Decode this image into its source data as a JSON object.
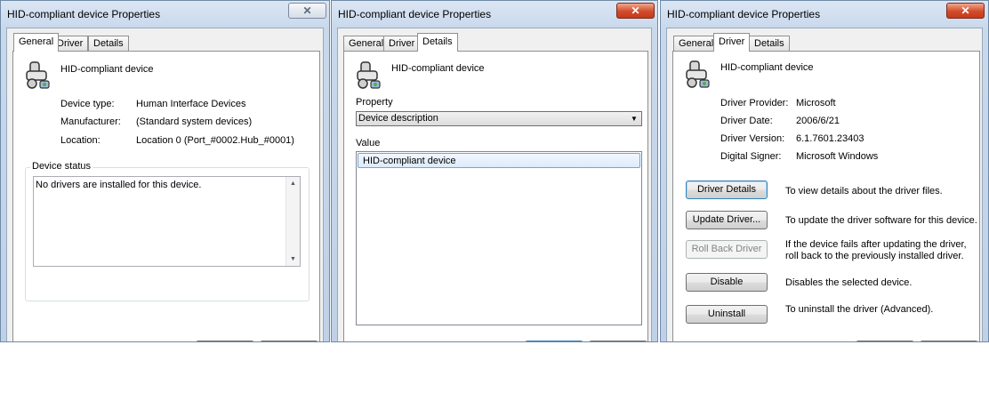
{
  "windows": [
    {
      "title": "HID-compliant device Properties",
      "close": "✕",
      "tabs": [
        "General",
        "Driver",
        "Details"
      ],
      "device_name": "HID-compliant device",
      "fields": [
        {
          "label": "Device type:",
          "value": "Human Interface Devices"
        },
        {
          "label": "Manufacturer:",
          "value": "(Standard system devices)"
        },
        {
          "label": "Location:",
          "value": "Location 0 (Port_#0002.Hub_#0001)"
        }
      ],
      "status_group_label": "Device status",
      "status_text": "No drivers are installed for this device."
    },
    {
      "title": "HID-compliant device Properties",
      "close": "✕",
      "tabs": [
        "General",
        "Driver",
        "Details"
      ],
      "device_name": "HID-compliant device",
      "property_label": "Property",
      "property_selected": "Device description",
      "value_label": "Value",
      "value_items": [
        "HID-compliant device"
      ]
    },
    {
      "title": "HID-compliant device Properties",
      "close": "✕",
      "tabs": [
        "General",
        "Driver",
        "Details"
      ],
      "device_name": "HID-compliant device",
      "fields": [
        {
          "label": "Driver Provider:",
          "value": "Microsoft"
        },
        {
          "label": "Driver Date:",
          "value": "2006/6/21"
        },
        {
          "label": "Driver Version:",
          "value": "6.1.7601.23403"
        },
        {
          "label": "Digital Signer:",
          "value": "Microsoft Windows"
        }
      ],
      "actions": [
        {
          "button": "Driver Details",
          "description": "To view details about the driver files."
        },
        {
          "button": "Update Driver...",
          "description": "To update the driver software for this device."
        },
        {
          "button": "Roll Back Driver",
          "description": "If the device fails after updating the driver, roll back to the previously installed driver."
        },
        {
          "button": "Disable",
          "description": "Disables the selected device."
        },
        {
          "button": "Uninstall",
          "description": "To uninstall the driver (Advanced)."
        }
      ]
    }
  ]
}
